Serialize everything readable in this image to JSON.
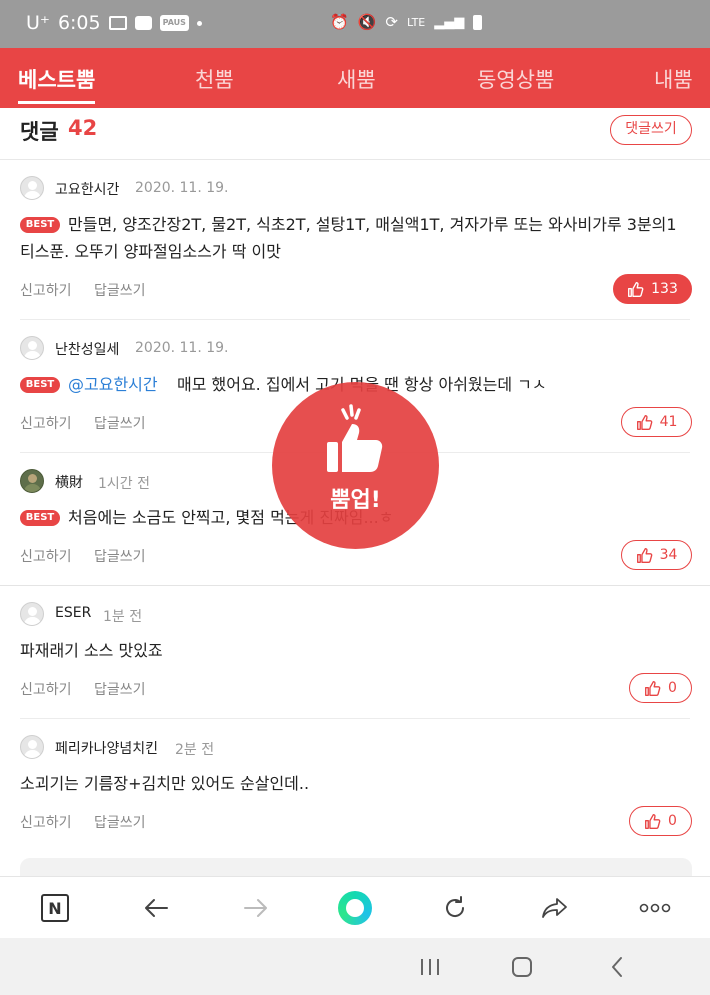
{
  "status_bar": {
    "carrier": "U⁺",
    "time": "6:05",
    "paus": "PAUS",
    "net": "LTE"
  },
  "tabs": [
    {
      "label": "베스트뿜",
      "active": true
    },
    {
      "label": "천뿜",
      "active": false
    },
    {
      "label": "새뿜",
      "active": false
    },
    {
      "label": "동영상뿜",
      "active": false
    },
    {
      "label": "내뿜",
      "active": false
    }
  ],
  "comments_header": {
    "title": "댓글",
    "count": "42",
    "write_label": "댓글쓰기"
  },
  "best_label": "BEST",
  "comments": [
    {
      "nickname": "고요한시간",
      "date": "2020. 11. 19.",
      "best": true,
      "line1": "만들면, 양조간장2T, 물2T, 식초2T, 설탕1T, 매실액1T, 겨자가루 또는 와사비가루 3분의1",
      "line2": "티스푼. 오뚜기 양파절임소스가 딱 이맛",
      "report": "신고하기",
      "reply": "답글쓰기",
      "likes": "133",
      "liked": true
    },
    {
      "nickname": "난찬성일세",
      "date": "2020. 11. 19.",
      "best": true,
      "mention": "@고요한시간",
      "text": "매모 했어요. 집에서 고기 먹을 땐 항상 아쉬웠는데 ㄱㅅ",
      "report": "신고하기",
      "reply": "답글쓰기",
      "likes": "41",
      "liked": false
    },
    {
      "nickname": "横財",
      "date": "1시간 전",
      "best": true,
      "text": "처음에는 소금도 안찍고, 몇점 먹는게 진짜임...ㅎ",
      "report": "신고하기",
      "reply": "답글쓰기",
      "likes": "34",
      "liked": false
    },
    {
      "nickname": "ESER",
      "date": "1분 전",
      "best": false,
      "text": "파재래기 소스 맛있죠",
      "report": "신고하기",
      "reply": "답글쓰기",
      "likes": "0",
      "liked": false
    },
    {
      "nickname": "페리카나양념치킨",
      "date": "2분 전",
      "best": false,
      "text": "소괴기는 기름장+김치만 있어도 순살인데..",
      "report": "신고하기",
      "reply": "답글쓰기",
      "likes": "0",
      "liked": false
    }
  ],
  "overlay": {
    "label": "뿜업!"
  },
  "toolbar": {
    "n_label": "N"
  },
  "colors": {
    "accent": "#e84545",
    "mention": "#2c7fd6",
    "status_bar": "#9b9b9b"
  },
  "icons": [
    "thumbs-up-icon",
    "back-arrow-icon",
    "forward-arrow-icon",
    "reload-icon",
    "share-icon",
    "more-icon",
    "recent-apps-icon",
    "home-icon",
    "back-icon"
  ]
}
